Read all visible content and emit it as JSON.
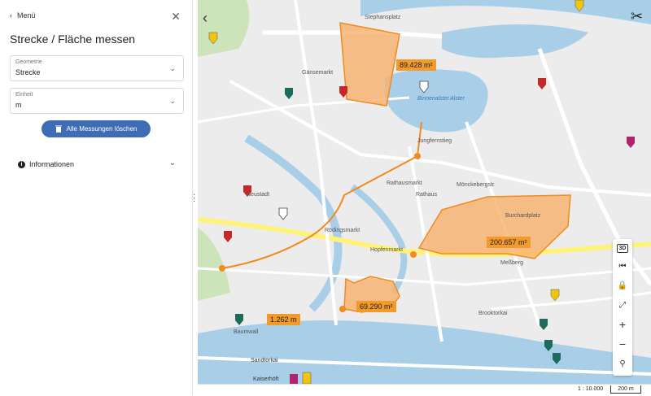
{
  "panel": {
    "back_label": "Menü",
    "title": "Strecke / Fläche messen",
    "geometry": {
      "label": "Geometrie",
      "value": "Strecke"
    },
    "unit": {
      "label": "Einheit",
      "value": "m"
    },
    "delete_label": "Alle Messungen löschen",
    "info_label": "Informationen"
  },
  "map": {
    "measurements": [
      "89.428 m²",
      "200.657 m²",
      "69.290 m²",
      "1.262 m"
    ],
    "labels": [
      "Binnenalster",
      "Alster",
      "Rathausmarkt",
      "Rathaus",
      "Jungfernstieg",
      "Stephansplatz",
      "Gänsemarkt",
      "Mönckebergstr.",
      "Rödingsmarkt",
      "Baumwall",
      "Hopfenmarkt",
      "Meßberg",
      "Brooktorkai",
      "Sandtorkai",
      "Kaiserhöft",
      "Neustadt",
      "Burchardplatz"
    ],
    "controls": {
      "d3": "3D"
    }
  },
  "status": {
    "scale": "1 : 10.000",
    "scalebar": "200 m"
  }
}
